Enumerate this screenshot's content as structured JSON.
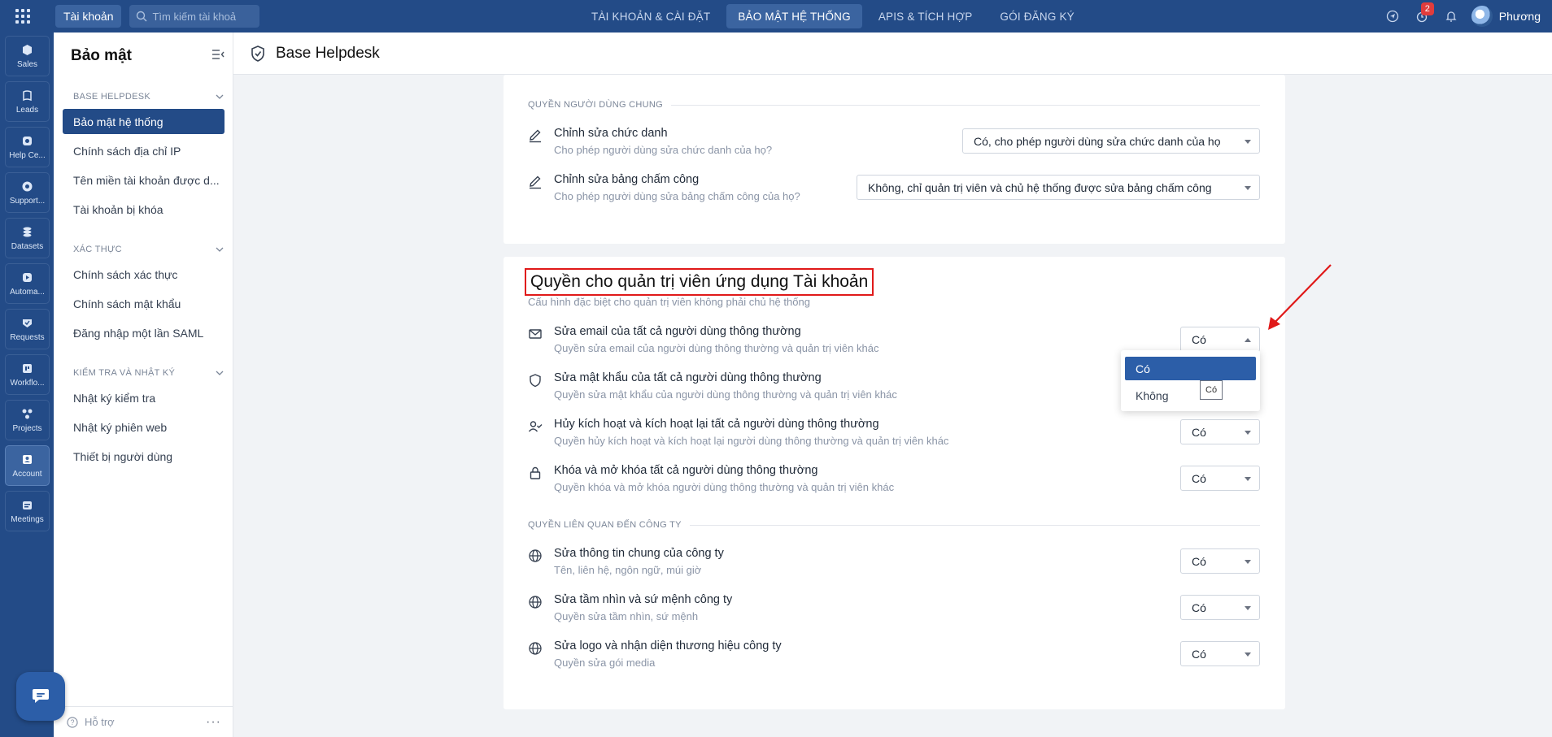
{
  "topbar": {
    "account_pill": "Tài khoản",
    "search_placeholder": "Tìm kiếm tài khoả",
    "nav": [
      "TÀI KHOẢN & CÀI ĐẶT",
      "BẢO MẬT HỆ THỐNG",
      "APIS & TÍCH HỢP",
      "GÓI ĐĂNG KÝ"
    ],
    "active_nav": 1,
    "notification_count": "2",
    "user_name": "Phương"
  },
  "rail": {
    "items": [
      {
        "label": "Sales",
        "icon": "sales-icon"
      },
      {
        "label": "Leads",
        "icon": "leads-icon"
      },
      {
        "label": "Help Ce...",
        "icon": "helpcenter-icon"
      },
      {
        "label": "Support...",
        "icon": "support-icon"
      },
      {
        "label": "Datasets",
        "icon": "datasets-icon"
      },
      {
        "label": "Automa...",
        "icon": "automation-icon"
      },
      {
        "label": "Requests",
        "icon": "requests-icon"
      },
      {
        "label": "Workflo...",
        "icon": "workflow-icon"
      },
      {
        "label": "Projects",
        "icon": "projects-icon"
      },
      {
        "label": "Account",
        "icon": "account-icon"
      },
      {
        "label": "Meetings",
        "icon": "meetings-icon"
      }
    ],
    "active_index": 9
  },
  "sidebar": {
    "title": "Bảo mật",
    "groups": [
      {
        "label": "BASE HELPDESK",
        "items": [
          "Bảo mật hệ thống",
          "Chính sách địa chỉ IP",
          "Tên miền tài khoản được d...",
          "Tài khoản bị khóa"
        ]
      },
      {
        "label": "XÁC THỰC",
        "items": [
          "Chính sách xác thực",
          "Chính sách mật khẩu",
          "Đăng nhập một lần SAML"
        ]
      },
      {
        "label": "KIỂM TRA VÀ NHẬT KÝ",
        "items": [
          "Nhật ký kiểm tra",
          "Nhật ký phiên web",
          "Thiết bị người dùng"
        ]
      }
    ],
    "footer": "Hỗ trợ"
  },
  "header": {
    "title": "Base Helpdesk"
  },
  "card1": {
    "section": "QUYỀN NGƯỜI DÙNG CHUNG",
    "rows": [
      {
        "title": "Chỉnh sửa chức danh",
        "desc": "Cho phép người dùng sửa chức danh của họ?",
        "value": "Có, cho phép người dùng sửa chức danh của họ",
        "icon": "pencil-icon"
      },
      {
        "title": "Chỉnh sửa bảng chấm công",
        "desc": "Cho phép người dùng sửa bảng chấm công của họ?",
        "value": "Không, chỉ quản trị viên và chủ hệ thống được sửa bảng chấm công",
        "icon": "pencil-icon"
      }
    ]
  },
  "card2": {
    "title": "Quyền cho quản trị viên ứng dụng Tài khoản",
    "subtitle": "Cấu hình đặc biệt cho quản trị viên không phải chủ hệ thống",
    "rows": [
      {
        "title": "Sửa email của tất cả người dùng thông thường",
        "desc": "Quyền sửa email của người dùng thông thường và quản trị viên khác",
        "value": "Có",
        "icon": "mail-icon"
      },
      {
        "title": "Sửa mật khẩu của tất cả người dùng thông thường",
        "desc": "Quyền sửa mật khẩu của người dùng thông thường và quản trị viên khác",
        "value": "Có",
        "icon": "shield-icon"
      },
      {
        "title": "Hủy kích hoạt và kích hoạt lại tất cả người dùng thông thường",
        "desc": "Quyền hủy kích hoạt và kích hoạt lại người dùng thông thường và quản trị viên khác",
        "value": "Có",
        "icon": "user-check-icon"
      },
      {
        "title": "Khóa và mở khóa tất cả người dùng thông thường",
        "desc": "Quyền khóa và mở khóa người dùng thông thường và quản trị viên khác",
        "value": "Có",
        "icon": "lock-icon"
      }
    ],
    "section2": "QUYỀN LIÊN QUAN ĐẾN CÔNG TY",
    "rows2": [
      {
        "title": "Sửa thông tin chung của công ty",
        "desc": "Tên, liên hệ, ngôn ngữ, múi giờ",
        "value": "Có",
        "icon": "globe-icon"
      },
      {
        "title": "Sửa tầm nhìn và sứ mệnh công ty",
        "desc": "Quyền sửa tầm nhìn, sứ mệnh",
        "value": "Có",
        "icon": "globe-icon"
      },
      {
        "title": "Sửa logo và nhận diện thương hiệu công ty",
        "desc": "Quyền sửa gói media",
        "value": "Có",
        "icon": "globe-icon"
      }
    ]
  },
  "dropdown": {
    "options": [
      "Có",
      "Không"
    ],
    "selected": 0,
    "tooltip": "Có"
  },
  "colors": {
    "brand": "#234b87",
    "accent": "#2c5ea8",
    "highlight_box": "#e01919",
    "annotation_arrow": "#e01919"
  }
}
